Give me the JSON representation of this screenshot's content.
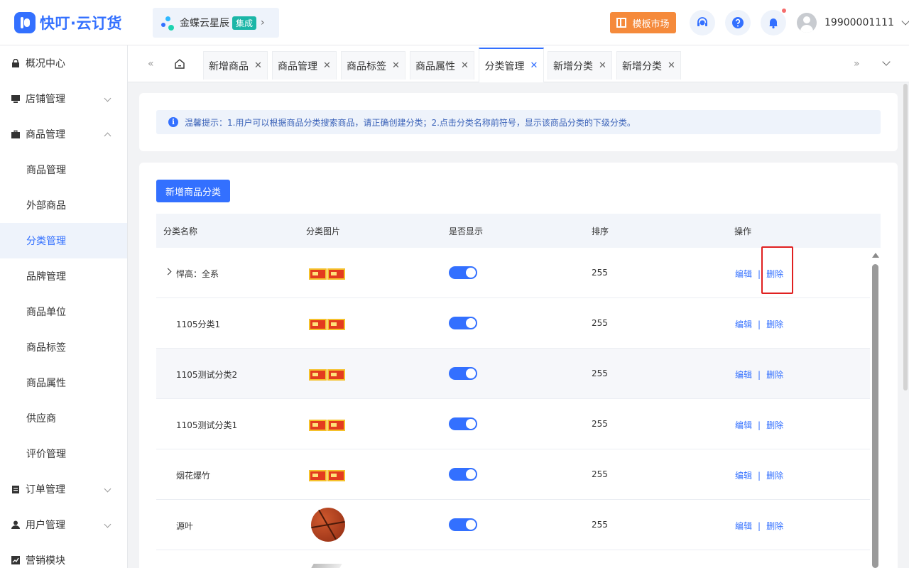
{
  "header": {
    "logo_text": "快叮·云订货",
    "kingdee": {
      "text": "金蝶云星辰",
      "badge": "集成",
      "arrow": "›"
    },
    "template_market": "模板市场",
    "username": "19900001111"
  },
  "sidebar": {
    "items": [
      {
        "label": "概况中心",
        "type": "group"
      },
      {
        "label": "店铺管理",
        "type": "group"
      },
      {
        "label": "商品管理",
        "type": "group"
      },
      {
        "label": "商品管理",
        "type": "child"
      },
      {
        "label": "外部商品",
        "type": "child"
      },
      {
        "label": "分类管理",
        "type": "child"
      },
      {
        "label": "品牌管理",
        "type": "child"
      },
      {
        "label": "商品单位",
        "type": "child"
      },
      {
        "label": "商品标签",
        "type": "child"
      },
      {
        "label": "商品属性",
        "type": "child"
      },
      {
        "label": "供应商",
        "type": "child"
      },
      {
        "label": "评价管理",
        "type": "child"
      },
      {
        "label": "订单管理",
        "type": "group"
      },
      {
        "label": "用户管理",
        "type": "group"
      },
      {
        "label": "营销模块",
        "type": "group"
      }
    ]
  },
  "tabs": {
    "nav_left": "«",
    "nav_right": "»",
    "close_glyph": "✕",
    "items": [
      {
        "label": "新增商品"
      },
      {
        "label": "商品管理"
      },
      {
        "label": "商品标签"
      },
      {
        "label": "商品属性"
      },
      {
        "label": "分类管理"
      },
      {
        "label": "新增分类"
      },
      {
        "label": "新增分类"
      }
    ]
  },
  "tip": {
    "icon": "i",
    "text": "温馨提示：1.用户可以根据商品分类搜索商品，请正确创建分类；2.点击分类名称前符号，显示该商品分类的下级分类。"
  },
  "add_button": "新增商品分类",
  "table": {
    "headers": [
      "分类名称",
      "分类图片",
      "是否显示",
      "排序",
      "操作"
    ],
    "edit_label": "编辑",
    "separator": "|",
    "delete_label": "删除",
    "rows": [
      {
        "name": "悍高：全系",
        "sort": "255"
      },
      {
        "name": "1105分类1",
        "sort": "255"
      },
      {
        "name": "1105测试分类2",
        "sort": "255"
      },
      {
        "name": "1105测试分类1",
        "sort": "255"
      },
      {
        "name": "烟花爆竹",
        "sort": "255"
      },
      {
        "name": "源叶",
        "sort": "255"
      }
    ]
  }
}
